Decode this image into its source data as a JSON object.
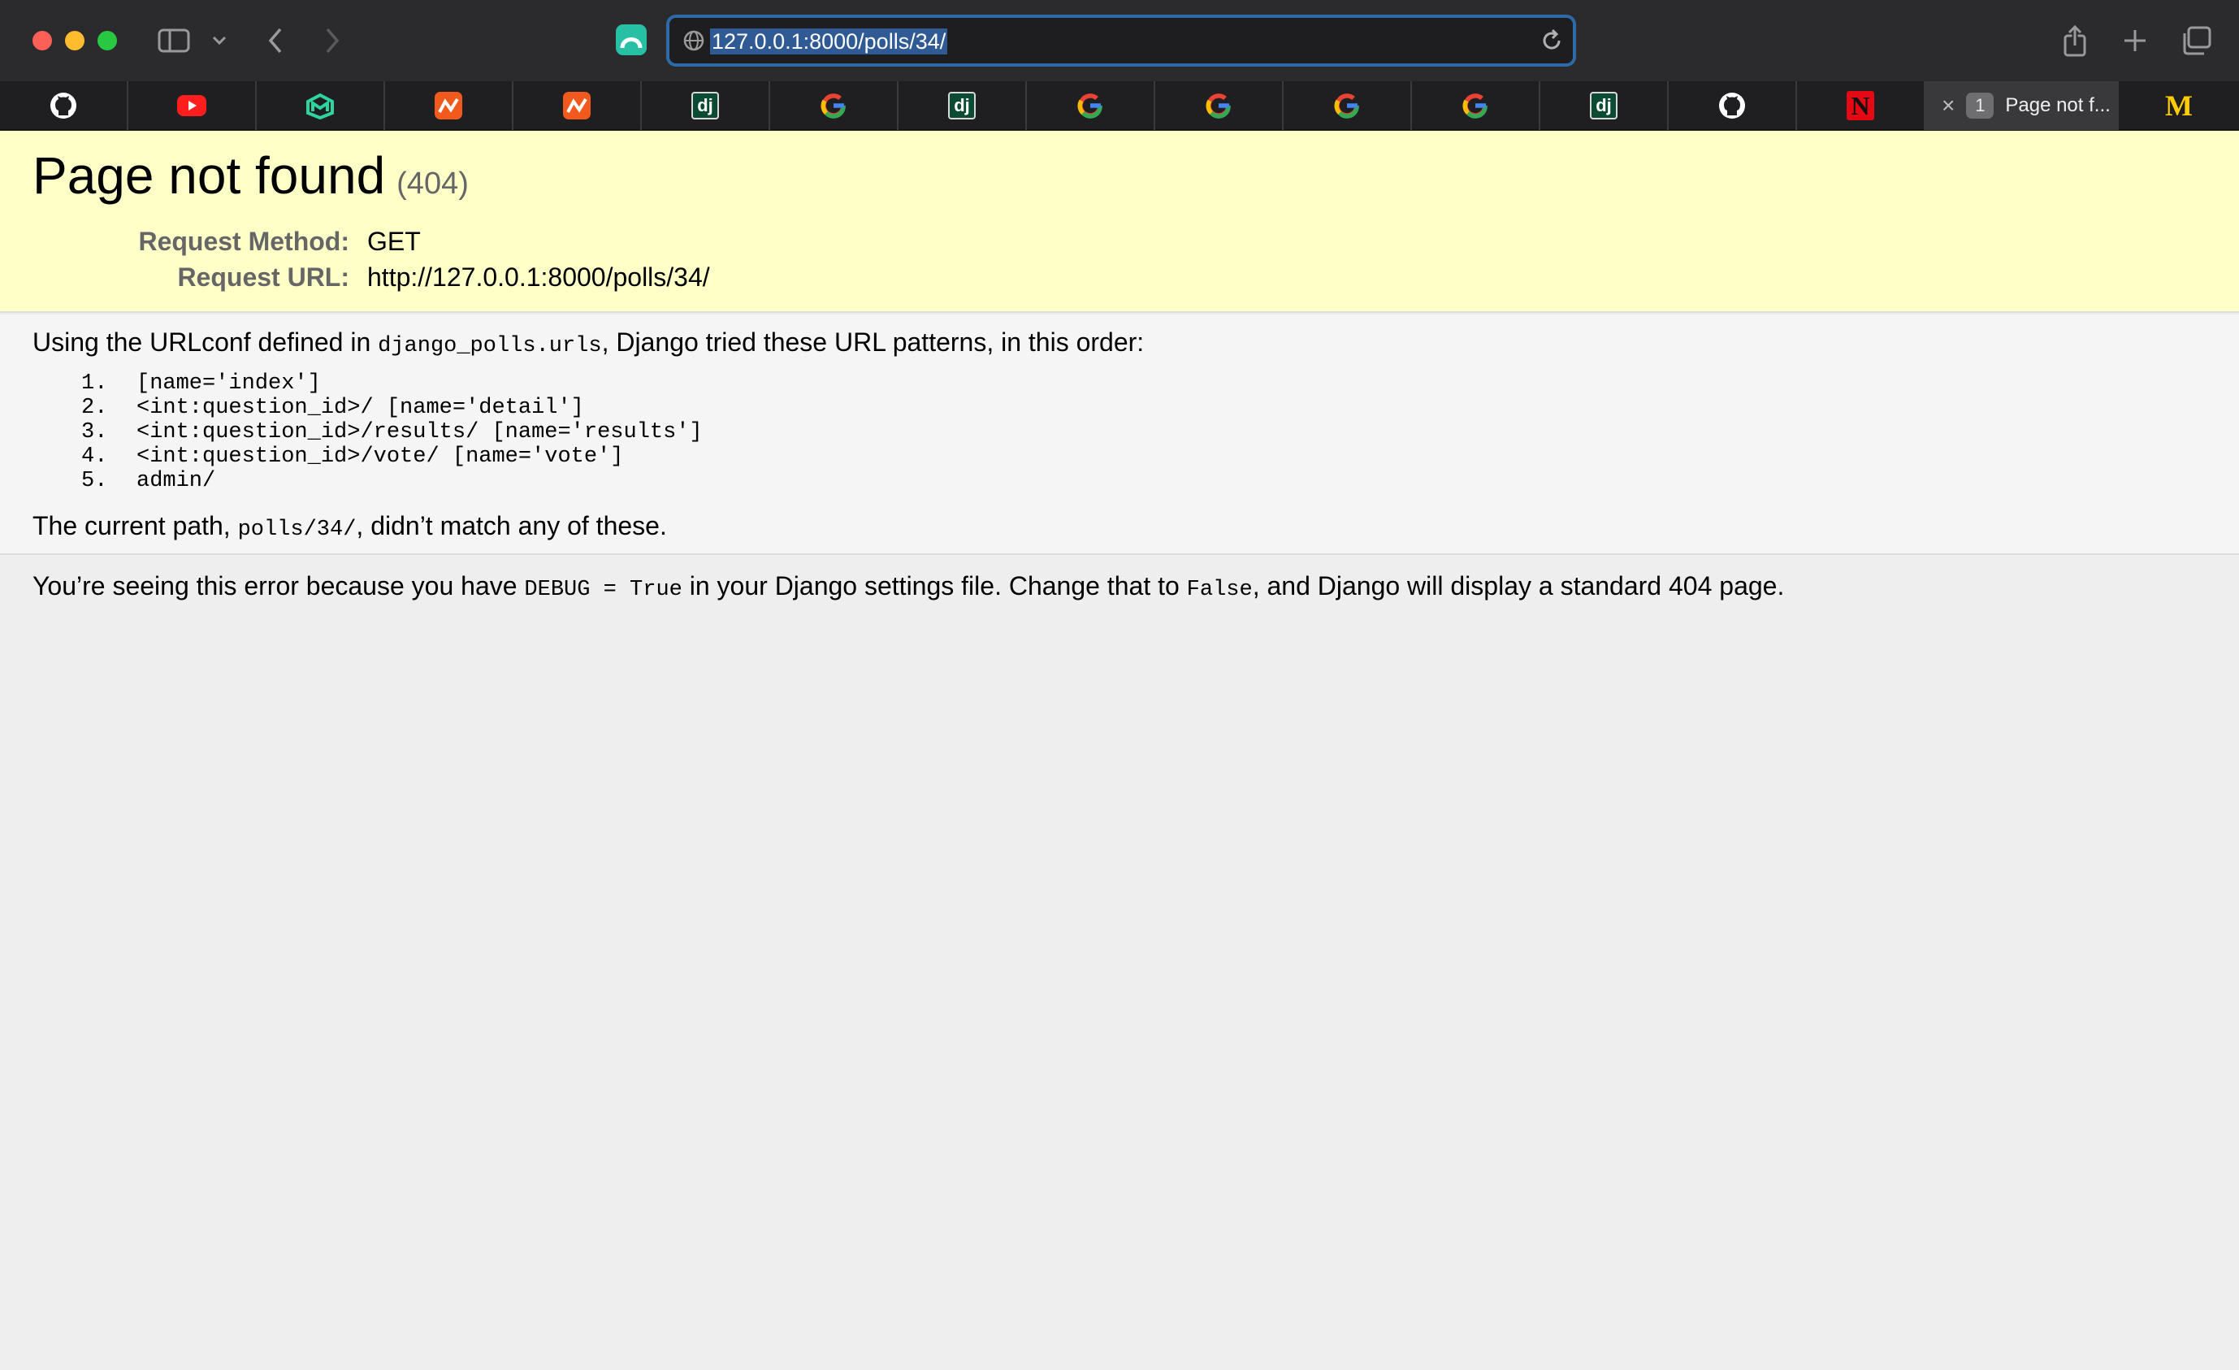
{
  "browser": {
    "address": "127.0.0.1:8000/polls/34/",
    "active_tab": {
      "badge": "1",
      "title": "Page not f..."
    },
    "favicons": [
      "github-icon",
      "youtube-icon",
      "malt-icon",
      "hackerrank-icon",
      "hackerrank-icon",
      "django-icon",
      "google-icon",
      "django-icon",
      "google-icon",
      "google-icon",
      "google-icon",
      "google-icon",
      "django-icon",
      "github-icon",
      "netflix-icon"
    ],
    "django_badge": "dj",
    "netflix_letter": "N",
    "last_tab_letter": "M"
  },
  "summary": {
    "title": "Page not found",
    "code": "(404)",
    "method_label": "Request Method:",
    "method_value": "GET",
    "url_label": "Request URL:",
    "url_value": "http://127.0.0.1:8000/polls/34/"
  },
  "info": {
    "intro_prefix": "Using the URLconf defined in ",
    "urlconf": "django_polls.urls",
    "intro_suffix": ", Django tried these URL patterns, in this order:",
    "patterns": [
      {
        "num": "1.",
        "text": "[name='index']"
      },
      {
        "num": "2.",
        "text": "<int:question_id>/ [name='detail']"
      },
      {
        "num": "3.",
        "text": "<int:question_id>/results/ [name='results']"
      },
      {
        "num": "4.",
        "text": "<int:question_id>/vote/ [name='vote']"
      },
      {
        "num": "5.",
        "text": "admin/"
      }
    ],
    "current_prefix": "The current path, ",
    "current_path": "polls/34/",
    "current_suffix": ", didn’t match any of these."
  },
  "explanation": {
    "part1": "You’re seeing this error because you have ",
    "debug_code": "DEBUG = True",
    "part2": " in your Django settings file. Change that to ",
    "false_code": "False",
    "part3": ", and Django will display a standard 404 page."
  },
  "colors": {
    "summary_bg": "#ffffc8",
    "info_bg": "#f5f5f5",
    "page_bg": "#eeeeee",
    "url_highlight": "#2f5a94"
  }
}
